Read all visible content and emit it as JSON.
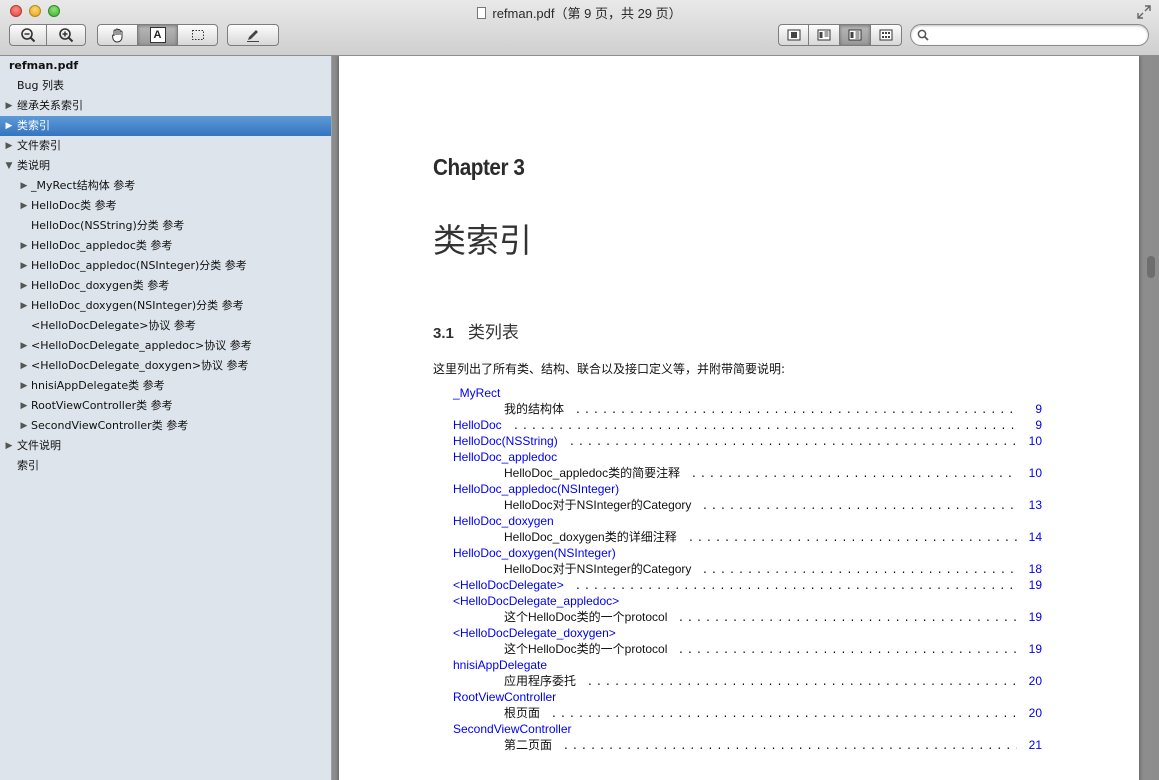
{
  "window": {
    "title": "refman.pdf（第 9 页，共 29 页）"
  },
  "toolbar": {
    "zoom_out": "zoom-out-icon",
    "zoom_in": "zoom-in-icon",
    "hand": "hand-tool-icon",
    "text_select": "A",
    "rect_select": "rect-select-icon",
    "annotate": "pencil-icon",
    "view_modes": [
      "single-page-icon",
      "two-page-icon",
      "continuous-icon",
      "contact-sheet-icon"
    ],
    "search_placeholder": ""
  },
  "sidebar": {
    "items": [
      {
        "label": "refman.pdf",
        "level": 0,
        "expander": "",
        "bold": true
      },
      {
        "label": "Bug 列表",
        "level": 1,
        "expander": ""
      },
      {
        "label": "继承关系索引",
        "level": 1,
        "expander": "▶"
      },
      {
        "label": "类索引",
        "level": 1,
        "expander": "▶",
        "selected": true
      },
      {
        "label": "文件索引",
        "level": 1,
        "expander": "▶"
      },
      {
        "label": "类说明",
        "level": 1,
        "expander": "▼"
      },
      {
        "label": "_MyRect结构体 参考",
        "level": 2,
        "expander": "▶"
      },
      {
        "label": "HelloDoc类 参考",
        "level": 2,
        "expander": "▶"
      },
      {
        "label": "HelloDoc(NSString)分类 参考",
        "level": 2,
        "expander": ""
      },
      {
        "label": "HelloDoc_appledoc类 参考",
        "level": 2,
        "expander": "▶"
      },
      {
        "label": "HelloDoc_appledoc(NSInteger)分类 参考",
        "level": 2,
        "expander": "▶"
      },
      {
        "label": "HelloDoc_doxygen类 参考",
        "level": 2,
        "expander": "▶"
      },
      {
        "label": "HelloDoc_doxygen(NSInteger)分类 参考",
        "level": 2,
        "expander": "▶"
      },
      {
        "label": "<HelloDocDelegate>协议 参考",
        "level": 2,
        "expander": ""
      },
      {
        "label": "<HelloDocDelegate_appledoc>协议 参考",
        "level": 2,
        "expander": "▶"
      },
      {
        "label": "<HelloDocDelegate_doxygen>协议 参考",
        "level": 2,
        "expander": "▶"
      },
      {
        "label": "hnisiAppDelegate类 参考",
        "level": 2,
        "expander": "▶"
      },
      {
        "label": "RootViewController类 参考",
        "level": 2,
        "expander": "▶"
      },
      {
        "label": "SecondViewController类 参考",
        "level": 2,
        "expander": "▶"
      },
      {
        "label": "文件说明",
        "level": 1,
        "expander": "▶"
      },
      {
        "label": "索引",
        "level": 1,
        "expander": ""
      }
    ]
  },
  "page": {
    "chapter": "Chapter 3",
    "chapter_title": "类索引",
    "section_number": "3.1",
    "section_title": "类列表",
    "intro": "这里列出了所有类、结构、联合以及接口定义等，并附带简要说明:",
    "toc": [
      {
        "text": "_MyRect",
        "kind": "link",
        "page": ""
      },
      {
        "text": "我的结构体",
        "kind": "desc",
        "page": "9"
      },
      {
        "text": "HelloDoc",
        "kind": "link",
        "page": "9"
      },
      {
        "text": "HelloDoc(NSString)",
        "kind": "link",
        "page": "10"
      },
      {
        "text": "HelloDoc_appledoc",
        "kind": "link",
        "page": ""
      },
      {
        "text": "HelloDoc_appledoc类的简要注释",
        "kind": "desc",
        "page": "10"
      },
      {
        "text": "HelloDoc_appledoc(NSInteger)",
        "kind": "link",
        "page": ""
      },
      {
        "text": "HelloDoc对于NSInteger的Category",
        "kind": "desc",
        "page": "13"
      },
      {
        "text": "HelloDoc_doxygen",
        "kind": "link",
        "page": ""
      },
      {
        "text": "HelloDoc_doxygen类的详细注释",
        "kind": "desc",
        "page": "14"
      },
      {
        "text": "HelloDoc_doxygen(NSInteger)",
        "kind": "link",
        "page": ""
      },
      {
        "text": "HelloDoc对于NSInteger的Category",
        "kind": "desc",
        "page": "18"
      },
      {
        "text": "<HelloDocDelegate>",
        "kind": "link",
        "page": "19"
      },
      {
        "text": "<HelloDocDelegate_appledoc>",
        "kind": "link",
        "page": ""
      },
      {
        "text": "这个HelloDoc类的一个protocol",
        "kind": "desc",
        "page": "19"
      },
      {
        "text": "<HelloDocDelegate_doxygen>",
        "kind": "link",
        "page": ""
      },
      {
        "text": "这个HelloDoc类的一个protocol",
        "kind": "desc",
        "page": "19"
      },
      {
        "text": "hnisiAppDelegate",
        "kind": "link",
        "page": ""
      },
      {
        "text": "应用程序委托",
        "kind": "desc",
        "page": "20"
      },
      {
        "text": "RootViewController",
        "kind": "link",
        "page": ""
      },
      {
        "text": "根页面",
        "kind": "desc",
        "page": "20"
      },
      {
        "text": "SecondViewController",
        "kind": "link",
        "page": ""
      },
      {
        "text": "第二页面",
        "kind": "desc",
        "page": "21"
      }
    ]
  },
  "colors": {
    "link": "#0000ee",
    "selection": "#3574bf",
    "sidebar_bg": "#dde4ec"
  }
}
